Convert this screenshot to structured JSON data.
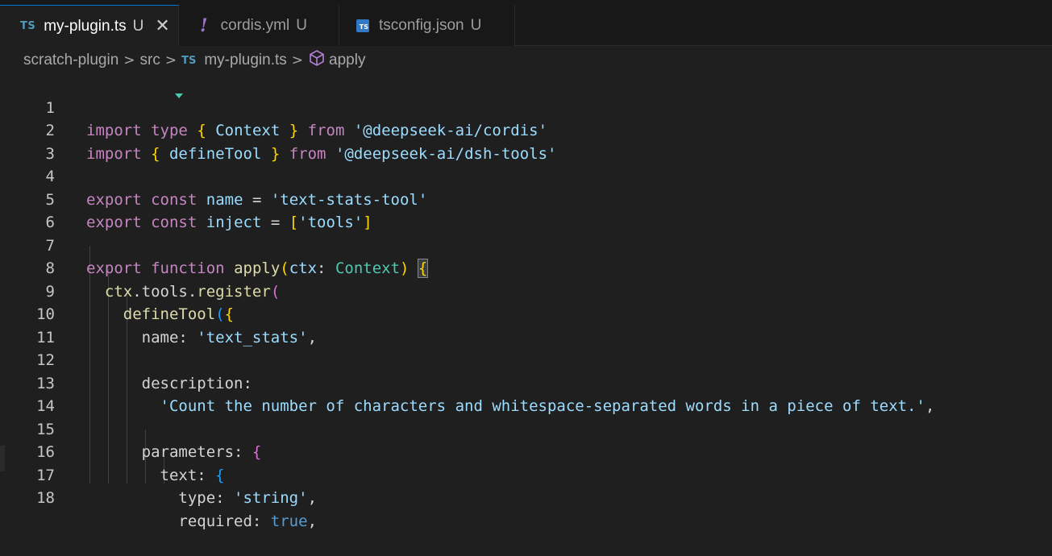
{
  "tabs": [
    {
      "glyph": "TS",
      "label": "my-plugin.ts",
      "status": "U",
      "close": "✕"
    },
    {
      "glyph": "!",
      "label": "cordis.yml",
      "status": "U"
    },
    {
      "glyph": "TS",
      "label": "tsconfig.json",
      "status": "U"
    }
  ],
  "breadcrumb": {
    "folder": "scratch-plugin",
    "sub": "src",
    "file_glyph": "TS",
    "file": "my-plugin.ts",
    "symbol": "apply",
    "sep": ">"
  },
  "code": {
    "line_numbers": [
      "1",
      "2",
      "3",
      "4",
      "5",
      "6",
      "7",
      "8",
      "9",
      "10",
      "11",
      "12",
      "13",
      "14",
      "15",
      "16",
      "17",
      "18"
    ],
    "l1": {
      "a": "import",
      "b": "type",
      "c": "{",
      "d": " Context ",
      "e": "}",
      "f": "from",
      "g": "'@deepseek-ai/cordis'"
    },
    "l2": {
      "a": "import",
      "c": "{",
      "d": " defineTool ",
      "e": "}",
      "f": "from",
      "g": "'@deepseek-ai/dsh-tools'"
    },
    "l4": {
      "a": "export",
      "b": "const",
      "c": "name",
      "d": " = ",
      "e": "'text-stats-tool'"
    },
    "l5": {
      "a": "export",
      "b": "const",
      "c": "inject",
      "d": " = ",
      "e": "[",
      "f": "'tools'",
      "g": "]"
    },
    "l7": {
      "a": "export",
      "b": "function",
      "c": "apply",
      "d": "(",
      "e": "ctx",
      "f": ": ",
      "g": "Context",
      "h": ")",
      "i": " ",
      "j": "{"
    },
    "l8": {
      "a": "ctx",
      "b": ".tools.",
      "c": "register",
      "d": "("
    },
    "l9": {
      "a": "defineTool",
      "b": "(",
      "c": "{"
    },
    "l10": {
      "a": "name",
      "b": ": ",
      "c": "'text_stats'",
      "d": ","
    },
    "l12": {
      "a": "description",
      "b": ":"
    },
    "l13": {
      "a": "'Count the number of characters and whitespace-separated words in a piece of text.'",
      "b": ","
    },
    "l15": {
      "a": "parameters",
      "b": ": ",
      "c": "{"
    },
    "l16": {
      "a": "text",
      "b": ": ",
      "c": "{"
    },
    "l17": {
      "a": "type",
      "b": ": ",
      "c": "'string'",
      "d": ","
    },
    "l18": {
      "a": "required",
      "b": ": ",
      "c": "true",
      "d": ","
    }
  },
  "colors": {
    "keyword": "#c586c0",
    "storage": "#569cd6",
    "variable": "#9cdcfe",
    "function": "#dcdcaa",
    "type": "#4ec9b0",
    "string": "#9cdcfe",
    "bracket1": "#ffd700",
    "bracket2": "#da70d6",
    "bracket3": "#179fff"
  }
}
